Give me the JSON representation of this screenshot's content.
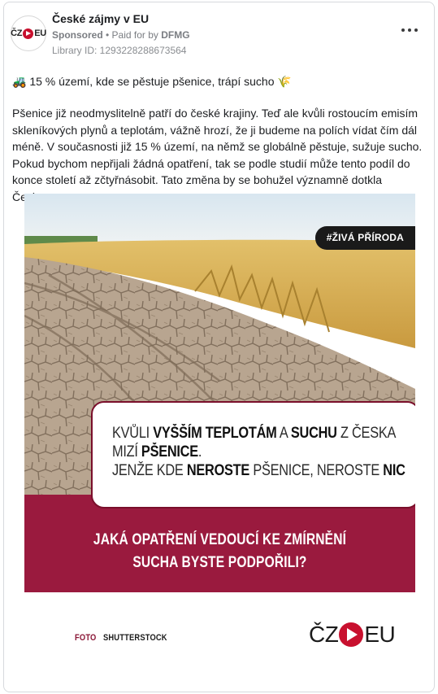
{
  "post": {
    "page_name": "České zájmy v EU",
    "sponsored_label": "Sponsored",
    "paid_for_prefix": "• Paid for by",
    "funder": "DFMG",
    "library_id": "Library ID: 1293228288673564",
    "more_icon": "more-horizontal-icon"
  },
  "avatar": {
    "left": "ČZ",
    "right": "EU"
  },
  "content": {
    "tractor_emoji": "🚜",
    "headline_text": " 15 % území, kde se pěstuje pšenice, trápí sucho ",
    "wheat_emoji": "🌾",
    "body": "Pšenice již neodmyslitelně patří do české krajiny. Teď ale kvůli rostoucím emisím skleníkových plynů a teplotám, vážně hrozí, že ji budeme na polích vídat čím dál méně. V současnosti již 15 % území, na němž se globálně pěstuje, sužuje sucho. Pokud bychom nepřijali žádná opatření, tak se podle studií může tento podíl do konce století až zčtyřnásobit. Tato změna by se bohužel významně dotkla Česka,…"
  },
  "creative": {
    "tag": "#ŽIVÁ PŘÍRODA",
    "line1": [
      "KVŮLI ",
      "VYŠŠÍM TEPLOTÁM",
      " A ",
      "SUCHU",
      " Z ČESKA"
    ],
    "line2": [
      "MIZÍ ",
      "PŠENICE",
      "."
    ],
    "line3": [
      "JENŽE KDE ",
      "NEROSTE",
      " PŠENICE, NEROSTE ",
      "NIC"
    ],
    "question_line1": "JAKÁ OPATŘENÍ VEDOUCÍ KE ZMÍRNĚNÍ",
    "question_line2": "SUCHA BYSTE PODPOŘILI?",
    "credit_label": "FOTO",
    "credit_source": "SHUTTERSTOCK",
    "brand_left": "ČZ",
    "brand_right": "EU"
  },
  "colors": {
    "maroon": "#9a1a3e",
    "brand_red": "#c8102e",
    "tag_bg": "#1a1a1a"
  }
}
